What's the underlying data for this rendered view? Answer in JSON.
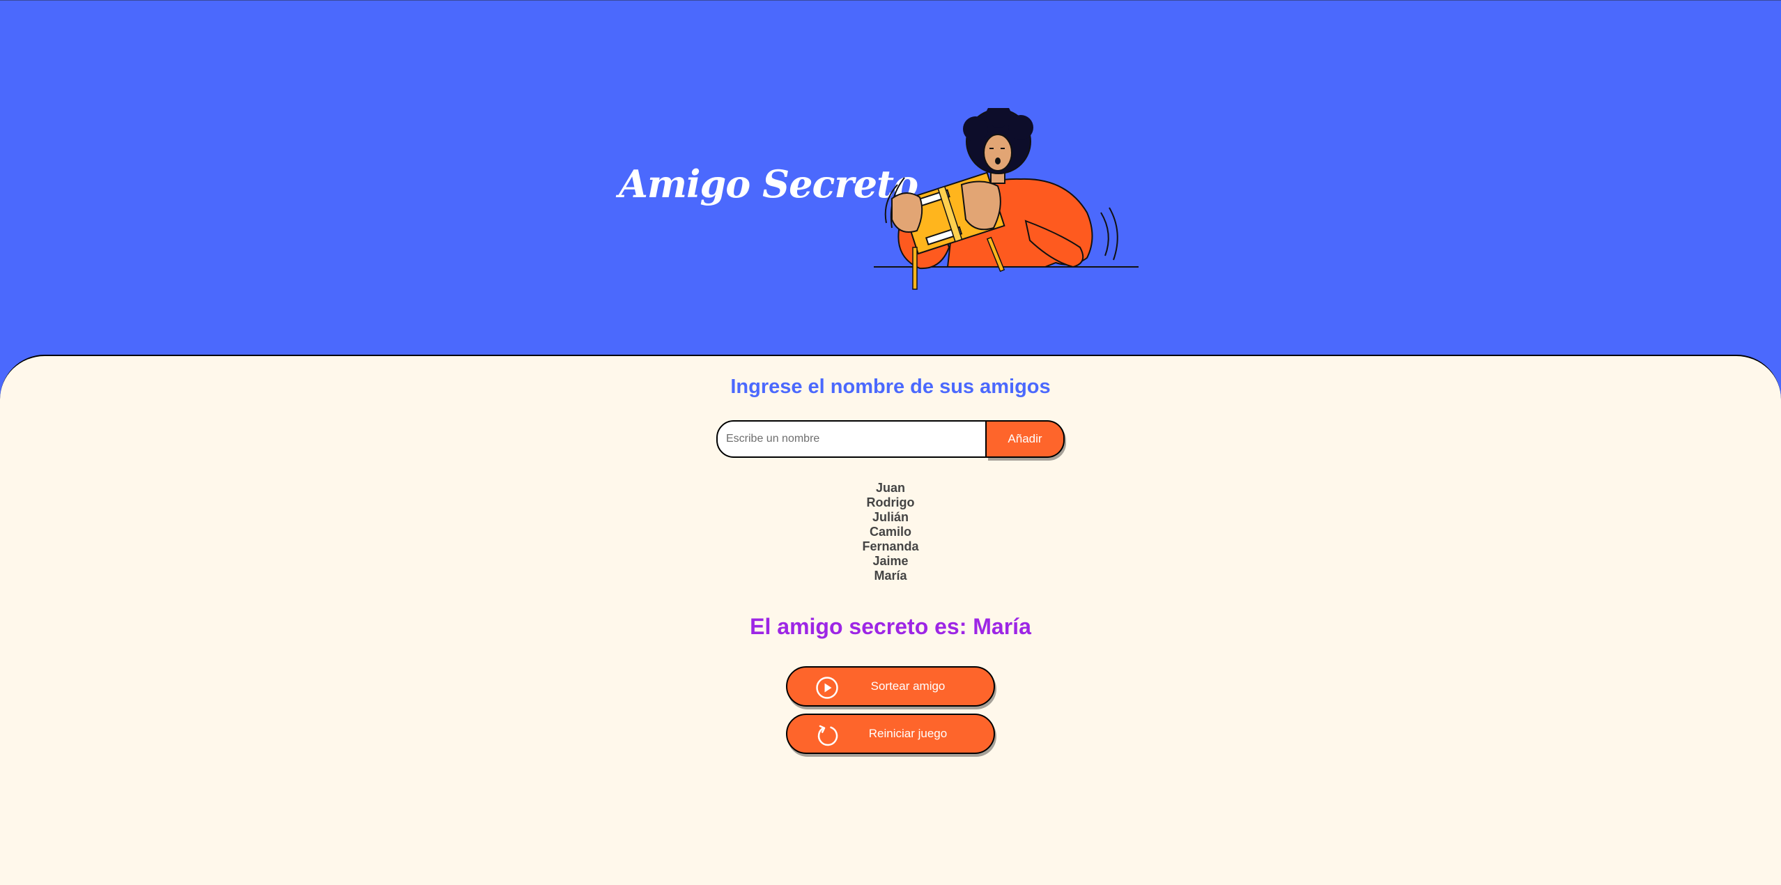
{
  "header": {
    "title": "Amigo Secreto",
    "illustration": "person-opening-gift-illustration"
  },
  "main": {
    "section_title": "Ingrese el nombre de sus amigos",
    "input": {
      "placeholder": "Escribe un nombre",
      "value": ""
    },
    "add_button_label": "Añadir",
    "friends": [
      "Juan",
      "Rodrigo",
      "Julián",
      "Camilo",
      "Fernanda",
      "Jaime",
      "María"
    ],
    "result_text": "El amigo secreto es: María",
    "buttons": {
      "draw": {
        "label": "Sortear amigo",
        "icon": "play-circle-icon"
      },
      "reset": {
        "label": "Reiniciar juego",
        "icon": "restart-icon"
      }
    }
  },
  "colors": {
    "header_bg": "#4b69fd",
    "main_bg": "#fff8eb",
    "accent_orange": "#fe652b",
    "title_blue": "#4b69fd",
    "result_purple": "#9d26e5",
    "list_text": "#444444"
  }
}
